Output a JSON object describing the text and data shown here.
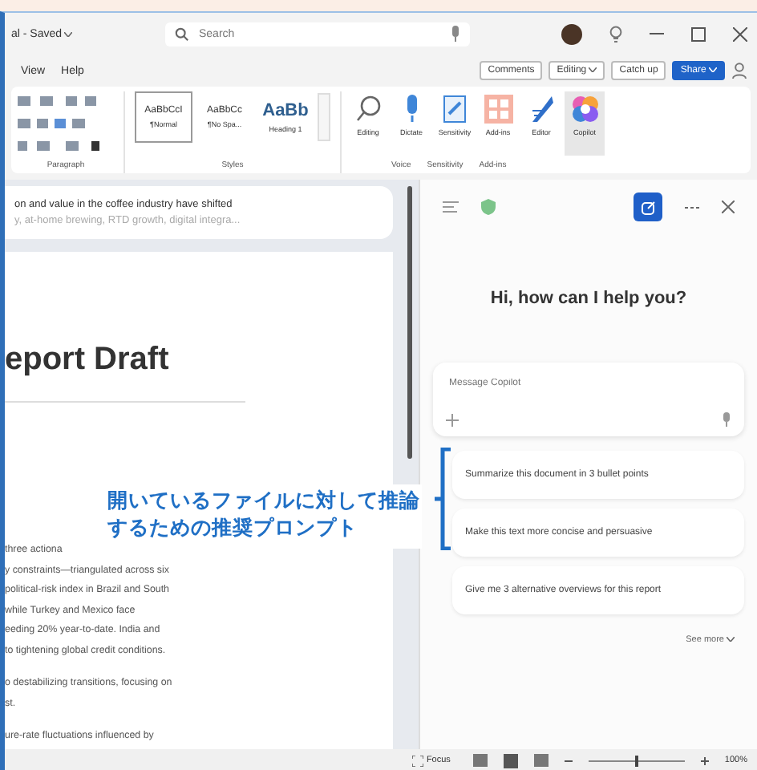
{
  "title_bar": {
    "doc_title": "al - Saved",
    "search_placeholder": "Search"
  },
  "menu": [
    "View",
    "Help"
  ],
  "header_buttons": [
    {
      "label": "Comments",
      "kind": "plain"
    },
    {
      "label": "Editing",
      "kind": "dropdown"
    },
    {
      "label": "Catch up",
      "kind": "plain"
    },
    {
      "label": "Share",
      "kind": "primary"
    }
  ],
  "ribbon": {
    "paragraph_label": "Paragraph",
    "styles_label": "Styles",
    "styles": [
      {
        "sample": "AaBbCcI",
        "name": "¶Normal",
        "selected": true,
        "kind": "normal"
      },
      {
        "sample": "AaBbCc",
        "name": "¶No Spa...",
        "selected": false,
        "kind": "normal"
      },
      {
        "sample": "AaBb",
        "name": "Heading 1",
        "selected": false,
        "kind": "heading"
      }
    ],
    "tools": [
      {
        "label": "Editing",
        "kind": "search",
        "selected": false
      },
      {
        "label": "Dictate",
        "kind": "mic",
        "selected": false
      },
      {
        "label": "Sensitivity",
        "kind": "sensitivity",
        "selected": false
      },
      {
        "label": "Add-ins",
        "kind": "addins",
        "selected": false
      },
      {
        "label": "Editor",
        "kind": "editor",
        "selected": false
      },
      {
        "label": "Copilot",
        "kind": "copilot",
        "selected": true
      }
    ],
    "group_labels": [
      "Voice",
      "Sensitivity",
      "Add-ins"
    ]
  },
  "document": {
    "banner": [
      "on and value in the coffee industry have shifted",
      "y, at-home brewing, RTD growth, digital integra..."
    ],
    "heading": "eport Draft",
    "paragraphs": [
      "three actiona\ny constraints—triangulated across six\npolitical-risk index in Brazil and South\nwhile Turkey and Mexico face\needing 20% year-to-date. India and\nto tightening global credit conditions.",
      "o destabilizing transitions, focusing on\nst.",
      "ure-rate fluctuations influenced by"
    ]
  },
  "callout": "開いているファイルに対して推論するための推奨プロンプト",
  "copilot": {
    "greeting": "Hi, how can I help you?",
    "placeholder": "Message Copilot",
    "prompts": [
      "Summarize this document in 3 bullet points",
      "Make this text more concise and persuasive",
      "Give me 3 alternative overviews for this report"
    ],
    "see_more": "See more"
  },
  "status_bar": {
    "focus": "Focus",
    "level": 0.5,
    "zoom": "100%"
  }
}
